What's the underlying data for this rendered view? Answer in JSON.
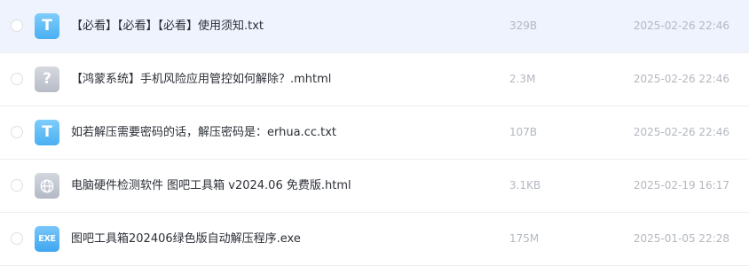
{
  "files": [
    {
      "name": "【必看】【必看】【必看】使用须知.txt",
      "size": "329B",
      "date": "2025-02-26 22:46",
      "icon": "txt-file-icon",
      "icon_glyph": "T",
      "selected": true
    },
    {
      "name": "【鸿蒙系统】手机风险应用管控如何解除？.mhtml",
      "size": "2.3M",
      "date": "2025-02-26 22:46",
      "icon": "unknown-file-icon",
      "icon_glyph": "?",
      "selected": false
    },
    {
      "name": "如若解压需要密码的话，解压密码是：erhua.cc.txt",
      "size": "107B",
      "date": "2025-02-26 22:46",
      "icon": "txt-file-icon",
      "icon_glyph": "T",
      "selected": false
    },
    {
      "name": "电脑硬件检测软件 图吧工具箱 v2024.06 免费版.html",
      "size": "3.1KB",
      "date": "2025-02-19 16:17",
      "icon": "html-globe-icon",
      "icon_glyph": "",
      "selected": false
    },
    {
      "name": "图吧工具箱202406绿色版自动解压程序.exe",
      "size": "175M",
      "date": "2025-01-05 22:28",
      "icon": "exe-file-icon",
      "icon_glyph": "EXE",
      "selected": false
    }
  ],
  "colors": {
    "selected_row_bg": "#eef3fd",
    "txt_icon": "#49aff2",
    "exe_icon": "#3fa6f0",
    "neutral_icon": "#b7bcc7",
    "meta_text": "#b4b8bf"
  }
}
